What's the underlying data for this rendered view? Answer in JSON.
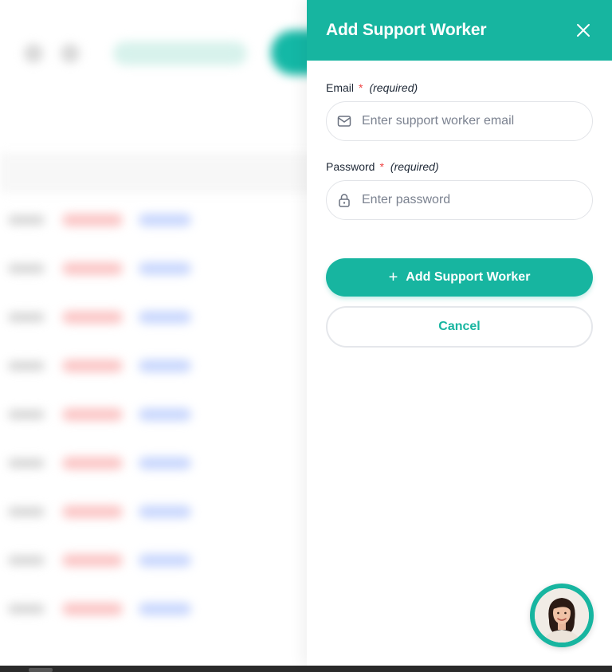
{
  "drawer": {
    "title": "Add Support Worker",
    "close_icon": "close-icon"
  },
  "form": {
    "email": {
      "label": "Email",
      "required_mark": "*",
      "required_note": "(required)",
      "placeholder": "Enter support worker email",
      "value": "",
      "icon": "envelope-icon"
    },
    "password": {
      "label": "Password",
      "required_mark": "*",
      "required_note": "(required)",
      "placeholder": "Enter password",
      "value": "",
      "icon": "lock-icon"
    },
    "submit_label": "Add Support Worker",
    "submit_icon": "plus-icon",
    "cancel_label": "Cancel"
  },
  "assistant": {
    "icon": "assistant-avatar"
  },
  "colors": {
    "accent": "#17b5a0",
    "required": "#ef4444",
    "background_overlay": "#ffffff"
  }
}
